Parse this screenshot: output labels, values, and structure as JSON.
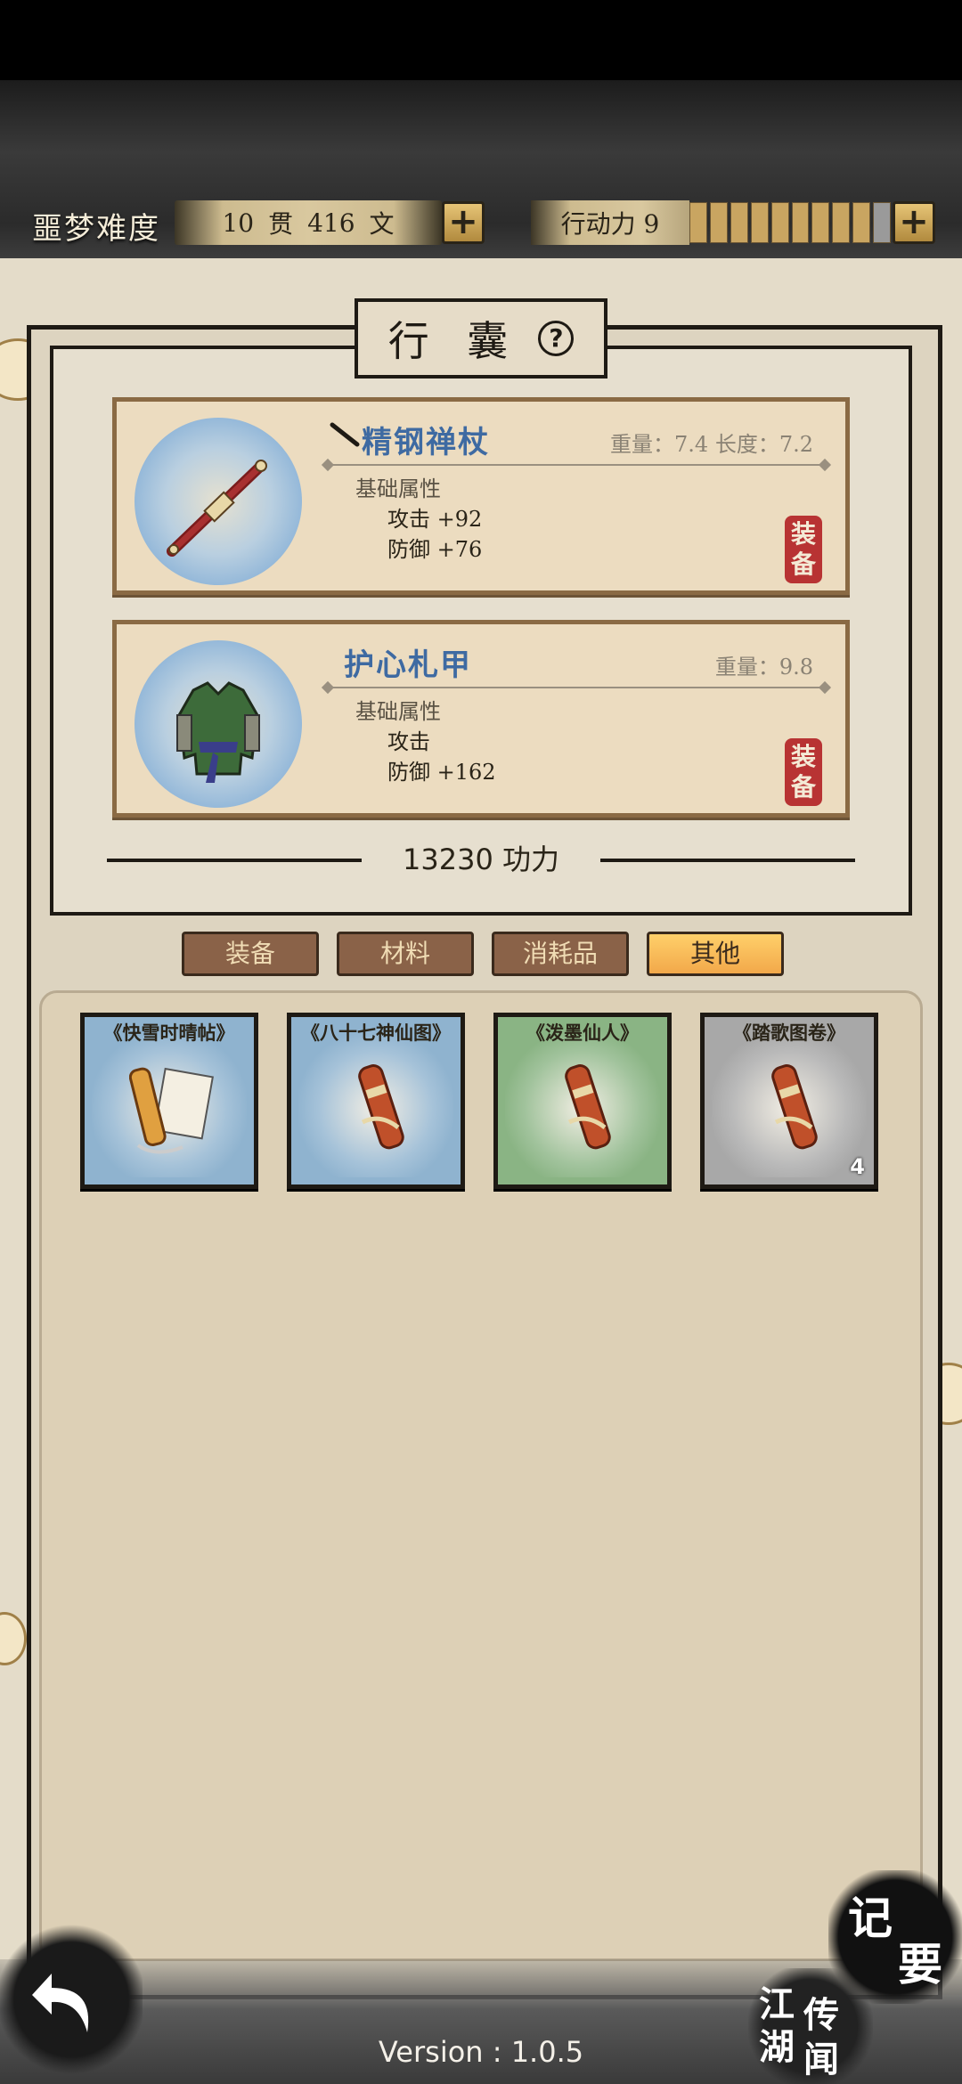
{
  "header": {
    "difficulty_label": "噩梦难度",
    "currency_guan": "10",
    "currency_guan_unit": "贯",
    "currency_wen": "416",
    "currency_wen_unit": "文",
    "action_points_label": "行动力 9",
    "action_points_current": 9,
    "action_points_max": 10
  },
  "panel": {
    "title": "行 囊",
    "help_symbol": "?"
  },
  "equipment": [
    {
      "name": "精钢禅杖",
      "stats_top": "重量：7.4  长度：7.2",
      "attr_title": "基础属性",
      "attack": "攻击 +92",
      "defense": "防御 +76",
      "stamp": "装\n备",
      "icon": "staff-icon"
    },
    {
      "name": "护心札甲",
      "stats_top": "重量：9.8",
      "attr_title": "基础属性",
      "attack": "攻击",
      "defense": "防御 +162",
      "stamp": "装\n备",
      "icon": "armor-icon"
    }
  ],
  "power": "13230 功力",
  "tabs": [
    {
      "label": "装备",
      "active": false
    },
    {
      "label": "材料",
      "active": false
    },
    {
      "label": "消耗品",
      "active": false
    },
    {
      "label": "其他",
      "active": true
    }
  ],
  "items": [
    {
      "name": "《快雪时晴帖》",
      "icon": "open-scroll-icon",
      "count": ""
    },
    {
      "name": "《八十七神仙图》",
      "icon": "rolled-scroll-icon",
      "count": ""
    },
    {
      "name": "《泼墨仙人》",
      "icon": "rolled-scroll-icon",
      "count": ""
    },
    {
      "name": "《踏歌图卷》",
      "icon": "rolled-scroll-icon",
      "count": "4"
    }
  ],
  "footer": {
    "notes_label_1": "记",
    "notes_label_2": "要",
    "rumor_1": "江",
    "rumor_2": "传",
    "rumor_3": "湖",
    "rumor_4": "闻",
    "version": "Version : 1.0.5"
  },
  "colors": {
    "active_tab": "#f2a84a",
    "tab": "#8a6248",
    "equip_name": "#3e6aa2",
    "stamp": "#b83333"
  }
}
